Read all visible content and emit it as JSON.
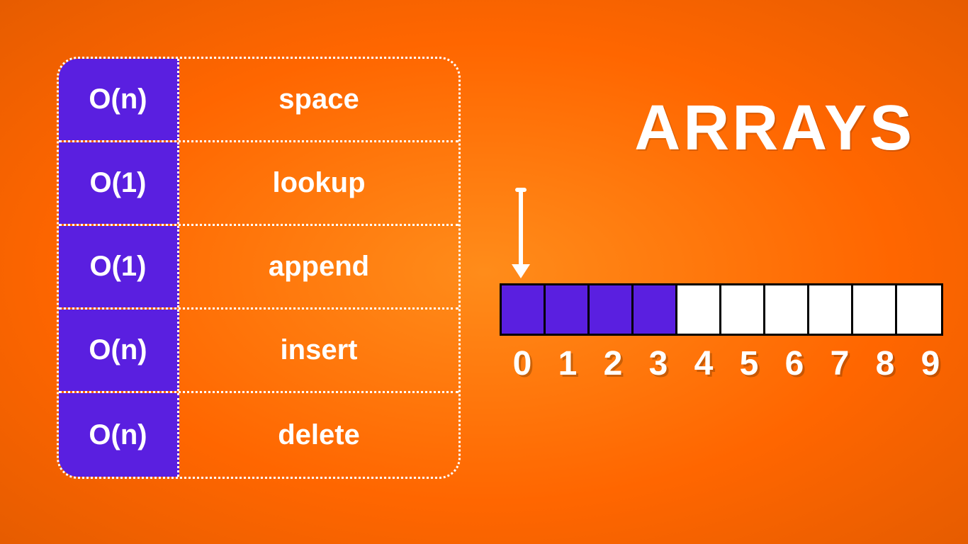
{
  "title": "ARRAYS",
  "complexity": {
    "rows": [
      {
        "bigO": "O(n)",
        "operation": "space"
      },
      {
        "bigO": "O(1)",
        "operation": "lookup"
      },
      {
        "bigO": "O(1)",
        "operation": "append"
      },
      {
        "bigO": "O(n)",
        "operation": "insert"
      },
      {
        "bigO": "O(n)",
        "operation": "delete"
      }
    ]
  },
  "array": {
    "cells": [
      {
        "filled": true
      },
      {
        "filled": true
      },
      {
        "filled": true
      },
      {
        "filled": true
      },
      {
        "filled": false
      },
      {
        "filled": false
      },
      {
        "filled": false
      },
      {
        "filled": false
      },
      {
        "filled": false
      },
      {
        "filled": false
      }
    ],
    "indices": [
      "0",
      "1",
      "2",
      "3",
      "4",
      "5",
      "6",
      "7",
      "8",
      "9"
    ]
  }
}
